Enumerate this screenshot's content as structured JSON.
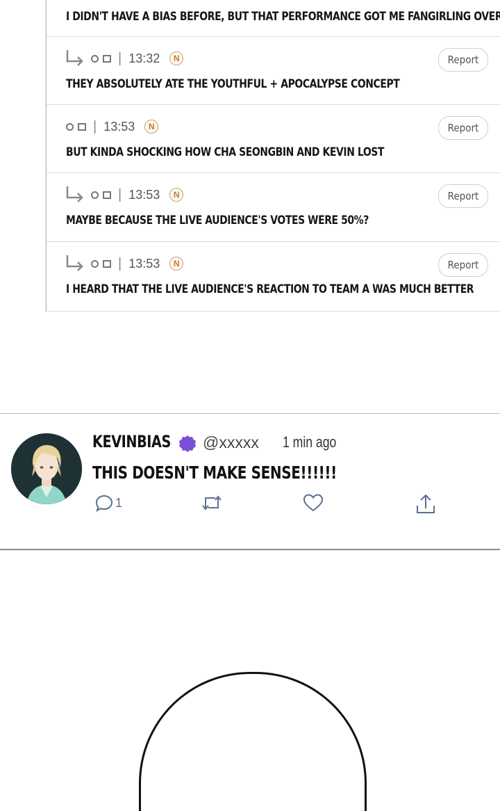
{
  "comments": [
    {
      "reply": false,
      "text": "I DIDN'T HAVE A BIAS BEFORE, BUT THAT PERFORMANCE GOT ME FANGIRLING OVER IAN"
    },
    {
      "reply": true,
      "time": "13:32",
      "badge": "N",
      "report": "Report",
      "text": "THEY ABSOLUTELY ATE THE YOUTHFUL + APOCALYPSE CONCEPT"
    },
    {
      "reply": false,
      "time": "13:53",
      "badge": "N",
      "report": "Report",
      "text": "BUT KINDA SHOCKING HOW CHA SEONGBIN AND KEVIN LOST"
    },
    {
      "reply": true,
      "time": "13:53",
      "badge": "N",
      "report": "Report",
      "text": "MAYBE BECAUSE THE LIVE AUDIENCE'S VOTES WERE 50%?"
    },
    {
      "reply": true,
      "time": "13:53",
      "badge": "N",
      "report": "Report",
      "text": "I HEARD THAT THE LIVE AUDIENCE'S REACTION TO TEAM A WAS MUCH BETTER"
    }
  ],
  "meta_separator": "|",
  "tweet": {
    "name": "KEVINBIAS",
    "handle": "@xxxxx",
    "time": "1 min ago",
    "text": "THIS DOESN'T MAKE SENSE!!!!!!",
    "reply_count": "1",
    "badge_color": "#7b4fd8"
  },
  "icons": [
    "reply-arrow-icon",
    "comment-icon",
    "retweet-icon",
    "heart-icon",
    "share-icon",
    "verified-badge-icon"
  ]
}
